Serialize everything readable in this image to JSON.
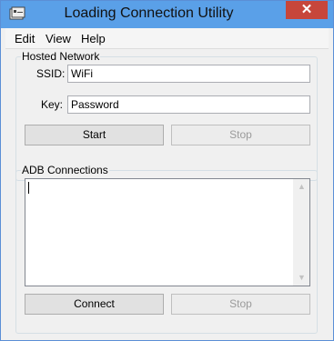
{
  "window": {
    "title": "Loading Connection Utility",
    "close_glyph": "✕"
  },
  "menu": {
    "items": [
      "Edit",
      "View",
      "Help"
    ]
  },
  "hosted_network": {
    "legend": "Hosted Network",
    "ssid_label": "SSID:",
    "ssid_value": "WiFi",
    "key_label": "Key:",
    "key_value": "Password",
    "start_label": "Start",
    "stop_label": "Stop"
  },
  "adb": {
    "legend": "ADB Connections",
    "log_text": "",
    "connect_label": "Connect",
    "stop_label": "Stop"
  },
  "icons": {
    "app": "app-window-icon",
    "close": "close-icon",
    "scroll_up": "scroll-up-arrow-icon",
    "scroll_down": "scroll-down-arrow-icon"
  },
  "colors": {
    "titlebar": "#5aa0e8",
    "close_button": "#c7463b",
    "window_bg": "#f0f0f0"
  }
}
